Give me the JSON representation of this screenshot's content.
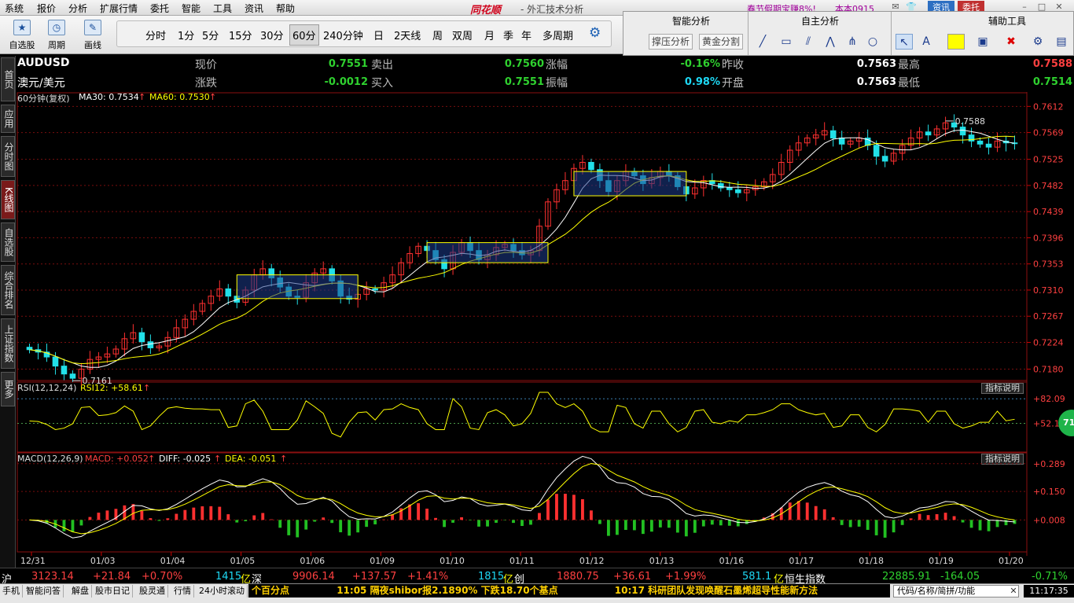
{
  "menu": {
    "items": [
      "系统",
      "报价",
      "分析",
      "扩展行情",
      "委托",
      "智能",
      "工具",
      "资讯",
      "帮助"
    ],
    "brand": "同花顺",
    "app_title": "- 外汇技术分析",
    "promo": "春节假期宝赚8%!",
    "user": "本本0915",
    "btn_news": "资讯",
    "btn_trade": "委托"
  },
  "toolbar": {
    "tools": [
      {
        "label": "自选股",
        "icon": "star-icon"
      },
      {
        "label": "周期",
        "icon": "clock-icon"
      },
      {
        "label": "画线",
        "icon": "pen-icon"
      }
    ],
    "periods": [
      "分时",
      "1分",
      "5分",
      "15分",
      "30分",
      "60分",
      "240分钟",
      "日",
      "2天线",
      "周",
      "双周",
      "月",
      "季",
      "年",
      "多周期"
    ],
    "active_period": "60分"
  },
  "panel": {
    "smart_title": "智能分析",
    "own_title": "自主分析",
    "aux_title": "辅助工具",
    "btn_support": "撑压分析",
    "btn_gold": "黄金分割",
    "color_swatch": "#ffff00"
  },
  "sidetabs": [
    "首页",
    "应用",
    "分时图",
    "K线图",
    "自选股",
    "综合排名",
    "上证指数",
    "更多"
  ],
  "quote": {
    "symbol": "AUDUSD",
    "name": "澳元/美元",
    "labels": [
      "现价",
      "涨跌",
      "卖出",
      "买入",
      "涨幅",
      "振幅",
      "昨收",
      "开盘",
      "最高",
      "最低"
    ],
    "price": "0.7551",
    "change": "-0.0012",
    "ask": "0.7560",
    "bid": "0.7551",
    "pct": "-0.16%",
    "amp": "0.98%",
    "prev": "0.7563",
    "open": "0.7563",
    "high": "0.7588",
    "low": "0.7514"
  },
  "ma": {
    "label": "60分钟(复权)",
    "ma30": "MA30: 0.7534",
    "ma60": "MA60: 0.7530",
    "arrow": "↑"
  },
  "rsi": {
    "label": "RSI(12,12,24)",
    "val": "RSI12: +58.61",
    "btn": "指标说明",
    "badge": "71"
  },
  "macd": {
    "label": "MACD(12,26,9)",
    "macd": "MACD: +0.052",
    "diff": "DIFF: -0.025",
    "dea": "DEA: -0.051",
    "btn": "指标说明"
  },
  "chart_data": {
    "type": "candlestick",
    "price_axis_ticks": [
      "0.7612",
      "0.7569",
      "0.7525",
      "0.7482",
      "0.7439",
      "0.7396",
      "0.7353",
      "0.7310",
      "0.7267",
      "0.7224",
      "0.7180"
    ],
    "ylim": [
      0.716,
      0.7615
    ],
    "price_annotations": [
      "0.7588",
      "0.7161"
    ],
    "x_labels": [
      "12/31",
      "01/03",
      "01/04",
      "01/05",
      "01/06",
      "01/09",
      "01/10",
      "01/11",
      "01/12",
      "01/13",
      "01/16",
      "01/17",
      "01/18",
      "01/19",
      "01/20"
    ],
    "close": [
      0.7212,
      0.7208,
      0.72,
      0.7185,
      0.7172,
      0.7165,
      0.718,
      0.7196,
      0.72,
      0.7205,
      0.7213,
      0.723,
      0.724,
      0.7225,
      0.7215,
      0.7218,
      0.7232,
      0.7248,
      0.7262,
      0.7275,
      0.7288,
      0.73,
      0.7312,
      0.73,
      0.729,
      0.731,
      0.7335,
      0.7345,
      0.733,
      0.7315,
      0.73,
      0.7298,
      0.7322,
      0.7338,
      0.7345,
      0.7325,
      0.73,
      0.7295,
      0.7303,
      0.7312,
      0.731,
      0.7322,
      0.7335,
      0.7355,
      0.737,
      0.7382,
      0.7375,
      0.736,
      0.7345,
      0.7372,
      0.7388,
      0.7375,
      0.736,
      0.7368,
      0.738,
      0.7385,
      0.7375,
      0.7368,
      0.7375,
      0.7415,
      0.7455,
      0.7475,
      0.749,
      0.751,
      0.752,
      0.7508,
      0.749,
      0.7472,
      0.749,
      0.7505,
      0.7498,
      0.7485,
      0.7495,
      0.7505,
      0.7498,
      0.748,
      0.7468,
      0.7478,
      0.749,
      0.7485,
      0.7478,
      0.7475,
      0.747,
      0.7475,
      0.748,
      0.7488,
      0.75,
      0.752,
      0.754,
      0.7552,
      0.756,
      0.7565,
      0.7572,
      0.756,
      0.755,
      0.7555,
      0.756,
      0.7548,
      0.753,
      0.7522,
      0.7535,
      0.7548,
      0.756,
      0.757,
      0.7565,
      0.7575,
      0.7585,
      0.7578,
      0.7565,
      0.7555,
      0.755,
      0.7545,
      0.7555,
      0.7552,
      0.7551
    ],
    "rsi_axis_ticks": [
      "+82.09",
      "+52.17"
    ],
    "macd_axis_ticks": [
      "+0.289",
      "+0.150",
      "+0.008"
    ]
  },
  "status": {
    "sh_label": "沪",
    "sh": "3123.14",
    "sh_chg": "+21.84",
    "sh_pct": "+0.70%",
    "sh_amt": "1415",
    "sh_unit": "亿",
    "sz_label": "深",
    "sz": "9906.14",
    "sz_chg": "+137.57",
    "sz_pct": "+1.41%",
    "sz_amt": "1815",
    "sz_unit": "亿",
    "cy_label": "创",
    "cy": "1880.75",
    "cy_chg": "+36.61",
    "cy_pct": "+1.99%",
    "cy_amt": "581.1",
    "cy_unit": "亿",
    "hs_label": "恒生指数",
    "hs": "22885.91",
    "hs_chg": "-164.05",
    "hs_pct": "-0.71%"
  },
  "bottom": {
    "buttons": [
      "手机",
      "智能问答",
      "解盘",
      "股市日记",
      "股灵通",
      "行情",
      "24小时滚动"
    ],
    "ticker1": "个百分点",
    "ticker2": "11:05 隔夜shibor报2.1890% 下跌18.70个基点",
    "ticker3": "10:17 科研团队发现唤醒石墨烯超导性能新方法",
    "search_placeholder": "代码/名称/简拼/功能",
    "clock": "11:17:35"
  }
}
